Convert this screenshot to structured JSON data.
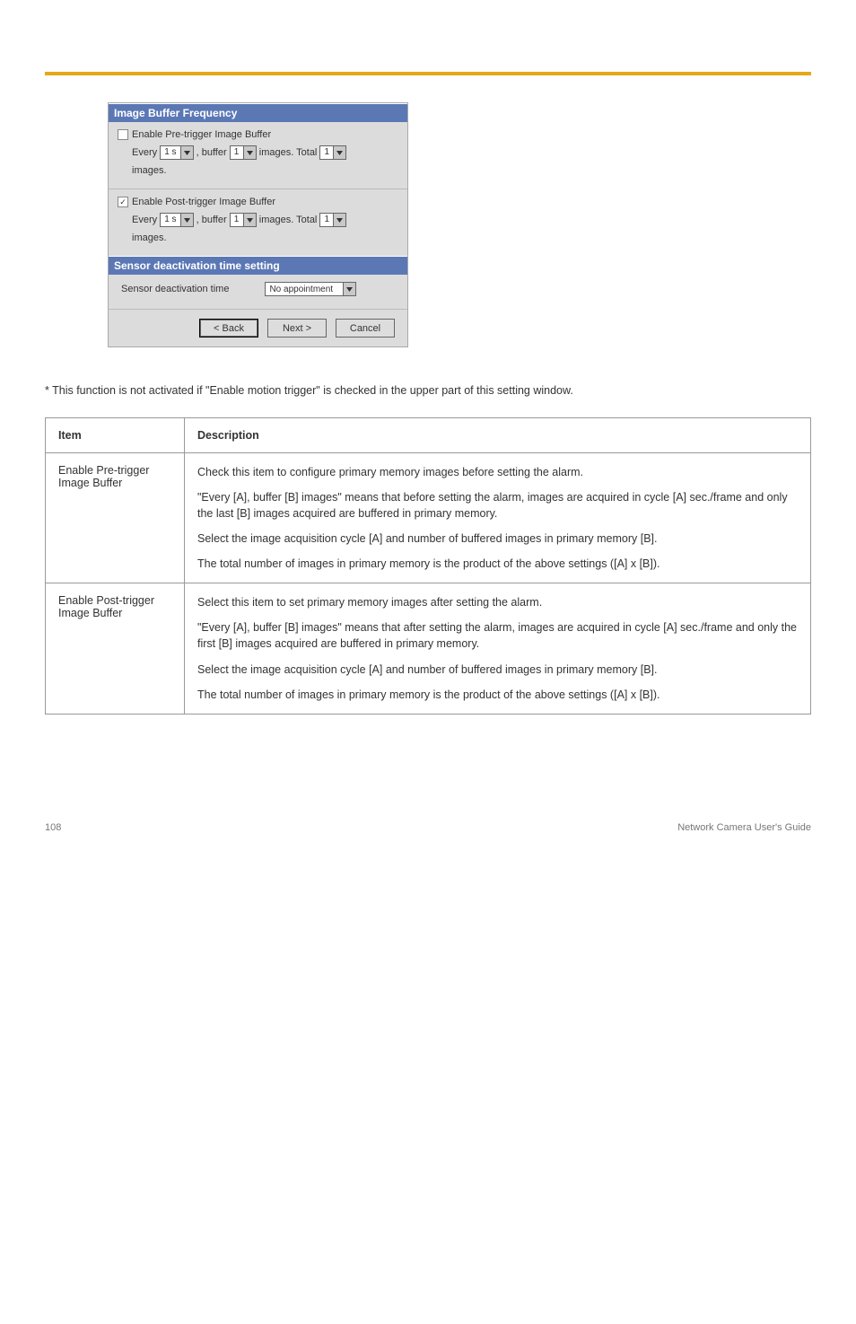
{
  "dialog": {
    "buffer_header": "Image Buffer Frequency",
    "pre_cb_label": "Enable Pre-trigger Image Buffer",
    "post_cb_label": "Enable Post-trigger Image Buffer",
    "sentence_every": "Every",
    "sentence_interval": "1 s",
    "sentence_buffer_word": ", buffer",
    "sentence_count": "1",
    "sentence_images_total": "images. Total",
    "sentence_total_val": "1",
    "sentence_tail": "images.",
    "deact_header": "Sensor deactivation time setting",
    "deact_label": "Sensor deactivation time",
    "deact_value": "No appointment",
    "btn_back": "< Back",
    "btn_next": "Next >",
    "btn_cancel": "Cancel"
  },
  "note": "* This function is not activated if \"Enable motion trigger\" is checked in the upper part of this setting window.",
  "table": {
    "col_item": "Item",
    "col_desc": "Description",
    "rows": [
      {
        "label": "Enable Pre-trigger Image Buffer",
        "paras": [
          "Check this item to configure primary memory images before setting the alarm.",
          "\"Every [A], buffer [B] images\" means that before setting the alarm, images are acquired in cycle [A] sec./frame and only the last [B] images acquired are buffered in primary memory.",
          "Select the image acquisition cycle [A] and number of buffered images in primary memory [B].",
          "The total number of images in primary memory is the product of the above settings ([A] x [B])."
        ]
      },
      {
        "label": "Enable Post-trigger Image Buffer",
        "paras": [
          "Select this item to set primary memory images after setting the alarm.",
          "\"Every [A], buffer [B] images\" means that after setting the alarm, images are acquired in cycle [A] sec./frame and only the first [B] images acquired are buffered in primary memory.",
          "Select the image acquisition cycle [A] and number of buffered images in primary memory [B].",
          "The total number of images in primary memory is the product of the above settings ([A] x [B])."
        ]
      }
    ]
  },
  "footer_left": "108",
  "footer_right": "Network Camera User's Guide"
}
